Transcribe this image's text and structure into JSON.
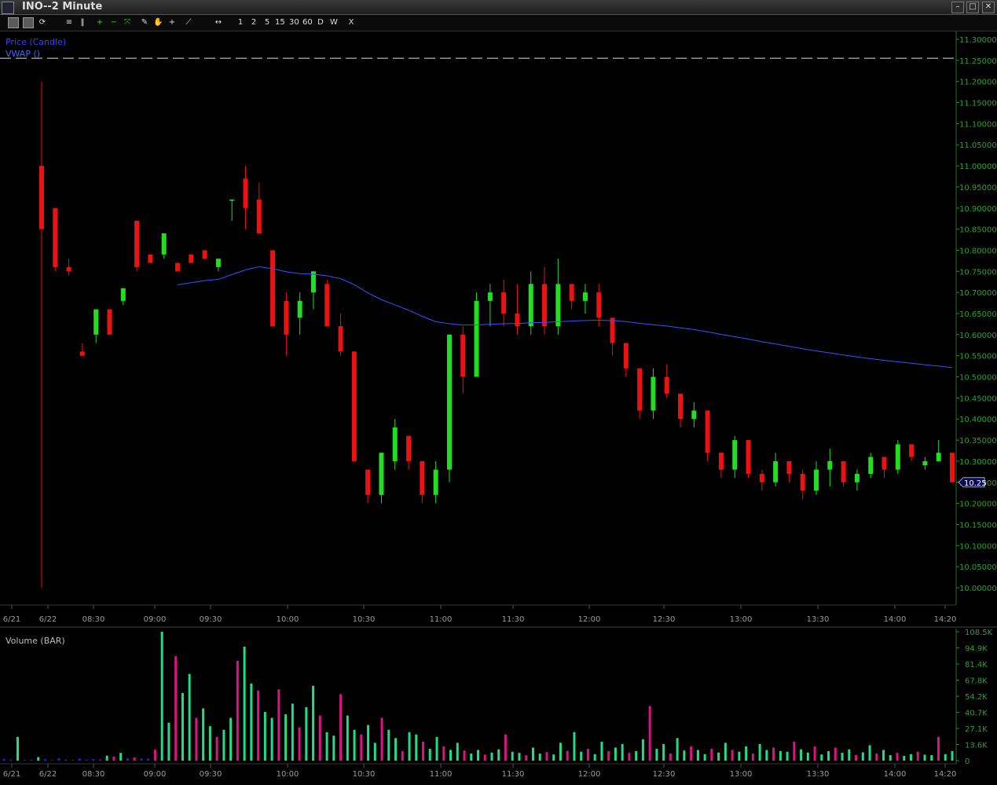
{
  "window": {
    "title": "INO--2 Minute",
    "buttons": [
      "minimize",
      "maximize",
      "close"
    ]
  },
  "toolbar": {
    "icon_buttons": [
      "chart-icon",
      "image-icon",
      "refresh-icon",
      "lines-icon",
      "bars-icon",
      "zoom-in-icon",
      "zoom-out-icon",
      "fit-icon",
      "pencil-icon",
      "hand-icon",
      "crosshair-icon",
      "draw-line-icon",
      "scroll-icon"
    ],
    "periods": [
      "1",
      "2",
      "5",
      "15",
      "30",
      "60",
      "D",
      "W",
      "X"
    ]
  },
  "chart_data": [
    {
      "type": "candlestick",
      "legend": [
        {
          "label": "Price (Candle)",
          "color": "#2233ff"
        },
        {
          "label": "VWAP ()",
          "color": "#3355ff"
        }
      ],
      "ylim": [
        10.0,
        11.3
      ],
      "y_ticks": [
        "11.30000",
        "11.25000",
        "11.20000",
        "11.15000",
        "11.10000",
        "11.05000",
        "11.00000",
        "10.95000",
        "10.90000",
        "10.85000",
        "10.80000",
        "10.75000",
        "10.70000",
        "10.65000",
        "10.60000",
        "10.55000",
        "10.50000",
        "10.45000",
        "10.40000",
        "10.35000",
        "10.30000",
        "10.25000",
        "10.20000",
        "10.15000",
        "10.10000",
        "10.05000",
        "10.00000"
      ],
      "x_ticks": [
        "6/21",
        "6/22",
        "08:30",
        "09:00",
        "09:30",
        "10:00",
        "10:30",
        "11:00",
        "11:30",
        "12:00",
        "12:30",
        "13:00",
        "13:30",
        "14:00",
        "14:20"
      ],
      "reference_line": 11.255,
      "last_price_label": "10.25",
      "last_price": 10.25,
      "candles_ohlc": [
        [
          11.0,
          11.2,
          10.0,
          10.85
        ],
        [
          10.9,
          10.9,
          10.75,
          10.76
        ],
        [
          10.76,
          10.78,
          10.74,
          10.75
        ],
        [
          10.56,
          10.58,
          10.55,
          10.55
        ],
        [
          10.6,
          10.66,
          10.58,
          10.66
        ],
        [
          10.66,
          10.66,
          10.6,
          10.6
        ],
        [
          10.68,
          10.71,
          10.67,
          10.71
        ],
        [
          10.87,
          10.87,
          10.75,
          10.76
        ],
        [
          10.79,
          10.79,
          10.77,
          10.77
        ],
        [
          10.79,
          10.84,
          10.78,
          10.84
        ],
        [
          10.77,
          10.77,
          10.75,
          10.75
        ],
        [
          10.79,
          10.79,
          10.77,
          10.77
        ],
        [
          10.8,
          10.8,
          10.78,
          10.78
        ],
        [
          10.76,
          10.78,
          10.75,
          10.78
        ],
        [
          10.92,
          10.92,
          10.87,
          10.92
        ],
        [
          10.97,
          11.0,
          10.85,
          10.9
        ],
        [
          10.92,
          10.96,
          10.84,
          10.84
        ],
        [
          10.8,
          10.8,
          10.62,
          10.62
        ],
        [
          10.68,
          10.7,
          10.55,
          10.6
        ],
        [
          10.64,
          10.7,
          10.6,
          10.68
        ],
        [
          10.7,
          10.75,
          10.66,
          10.75
        ],
        [
          10.72,
          10.73,
          10.62,
          10.62
        ],
        [
          10.62,
          10.65,
          10.55,
          10.56
        ],
        [
          10.56,
          10.56,
          10.3,
          10.3
        ],
        [
          10.28,
          10.28,
          10.2,
          10.22
        ],
        [
          10.22,
          10.32,
          10.2,
          10.32
        ],
        [
          10.3,
          10.4,
          10.28,
          10.38
        ],
        [
          10.36,
          10.36,
          10.28,
          10.3
        ],
        [
          10.3,
          10.3,
          10.2,
          10.22
        ],
        [
          10.22,
          10.3,
          10.2,
          10.28
        ],
        [
          10.28,
          10.6,
          10.25,
          10.6
        ],
        [
          10.6,
          10.62,
          10.46,
          10.5
        ],
        [
          10.5,
          10.7,
          10.5,
          10.68
        ],
        [
          10.68,
          10.72,
          10.62,
          10.7
        ],
        [
          10.7,
          10.73,
          10.62,
          10.65
        ],
        [
          10.65,
          10.72,
          10.6,
          10.62
        ],
        [
          10.62,
          10.75,
          10.6,
          10.72
        ],
        [
          10.72,
          10.76,
          10.6,
          10.62
        ],
        [
          10.62,
          10.78,
          10.6,
          10.72
        ],
        [
          10.72,
          10.72,
          10.66,
          10.68
        ],
        [
          10.68,
          10.72,
          10.65,
          10.7
        ],
        [
          10.7,
          10.72,
          10.62,
          10.64
        ],
        [
          10.64,
          10.64,
          10.55,
          10.58
        ],
        [
          10.58,
          10.58,
          10.5,
          10.52
        ],
        [
          10.52,
          10.52,
          10.4,
          10.42
        ],
        [
          10.42,
          10.52,
          10.4,
          10.5
        ],
        [
          10.5,
          10.53,
          10.45,
          10.46
        ],
        [
          10.46,
          10.46,
          10.38,
          10.4
        ],
        [
          10.4,
          10.44,
          10.38,
          10.42
        ],
        [
          10.42,
          10.42,
          10.3,
          10.32
        ],
        [
          10.32,
          10.32,
          10.26,
          10.28
        ],
        [
          10.28,
          10.36,
          10.26,
          10.35
        ],
        [
          10.35,
          10.35,
          10.26,
          10.27
        ],
        [
          10.27,
          10.28,
          10.23,
          10.25
        ],
        [
          10.25,
          10.32,
          10.24,
          10.3
        ],
        [
          10.3,
          10.3,
          10.25,
          10.27
        ],
        [
          10.27,
          10.28,
          10.21,
          10.23
        ],
        [
          10.23,
          10.3,
          10.22,
          10.28
        ],
        [
          10.28,
          10.33,
          10.24,
          10.3
        ],
        [
          10.3,
          10.3,
          10.24,
          10.25
        ],
        [
          10.25,
          10.28,
          10.23,
          10.27
        ],
        [
          10.27,
          10.32,
          10.26,
          10.31
        ],
        [
          10.31,
          10.31,
          10.26,
          10.28
        ],
        [
          10.28,
          10.35,
          10.27,
          10.34
        ],
        [
          10.34,
          10.34,
          10.3,
          10.31
        ],
        [
          10.29,
          10.31,
          10.28,
          10.3
        ],
        [
          10.3,
          10.35,
          10.3,
          10.32
        ],
        [
          10.32,
          10.32,
          10.26,
          10.25
        ]
      ]
    },
    {
      "type": "bar",
      "title": "Volume (BAR)",
      "ylim": [
        0,
        108500
      ],
      "y_ticks": [
        "108.5K",
        "94.9K",
        "81.4K",
        "67.8K",
        "54.2K",
        "40.7K",
        "27.1K",
        "13.6K",
        "0"
      ],
      "x_ticks": [
        "6/21",
        "6/22",
        "08:30",
        "09:00",
        "09:30",
        "10:00",
        "10:30",
        "11:00",
        "11:30",
        "12:00",
        "12:30",
        "13:00",
        "13:30",
        "14:00",
        "14:20"
      ],
      "values": [
        1500,
        800,
        20000,
        600,
        800,
        3000,
        1200,
        600,
        2000,
        900,
        600,
        1800,
        700,
        1300,
        1100,
        4200,
        3400,
        6500,
        2200,
        2600,
        1800,
        1700,
        9300,
        108500,
        32000,
        88000,
        57000,
        73000,
        36000,
        44000,
        29000,
        20000,
        26000,
        36000,
        84000,
        96000,
        65000,
        59000,
        41000,
        36000,
        60000,
        39000,
        48000,
        28000,
        45000,
        63000,
        38000,
        24000,
        21000,
        56000,
        38000,
        26000,
        22000,
        30000,
        15000,
        36000,
        26000,
        19000,
        8000,
        24000,
        22000,
        16000,
        10000,
        20000,
        12000,
        9000,
        15000,
        8500,
        6000,
        9000,
        5000,
        6800,
        9500,
        22000,
        7500,
        6500,
        4500,
        11000,
        6000,
        7200,
        5200,
        15000,
        8200,
        24000,
        7500,
        10000,
        5500,
        16000,
        8000,
        11000,
        14000,
        6500,
        8000,
        18000,
        46000,
        10000,
        14000,
        6000,
        19000,
        8500,
        12000,
        9000,
        5500,
        10000,
        6800,
        15000,
        9000,
        7500,
        12000,
        6000,
        14000,
        9000,
        11000,
        8000,
        7500,
        16000,
        9500,
        6800,
        12000,
        5200,
        8000,
        11000,
        6600,
        9500,
        4800,
        7000,
        13000,
        6000,
        9000,
        4600,
        6500,
        4000,
        5500,
        7500,
        5000,
        4600,
        20000,
        5500,
        8000
      ],
      "colors_note": "green = up, magenta = down, blue = unchanged"
    }
  ]
}
